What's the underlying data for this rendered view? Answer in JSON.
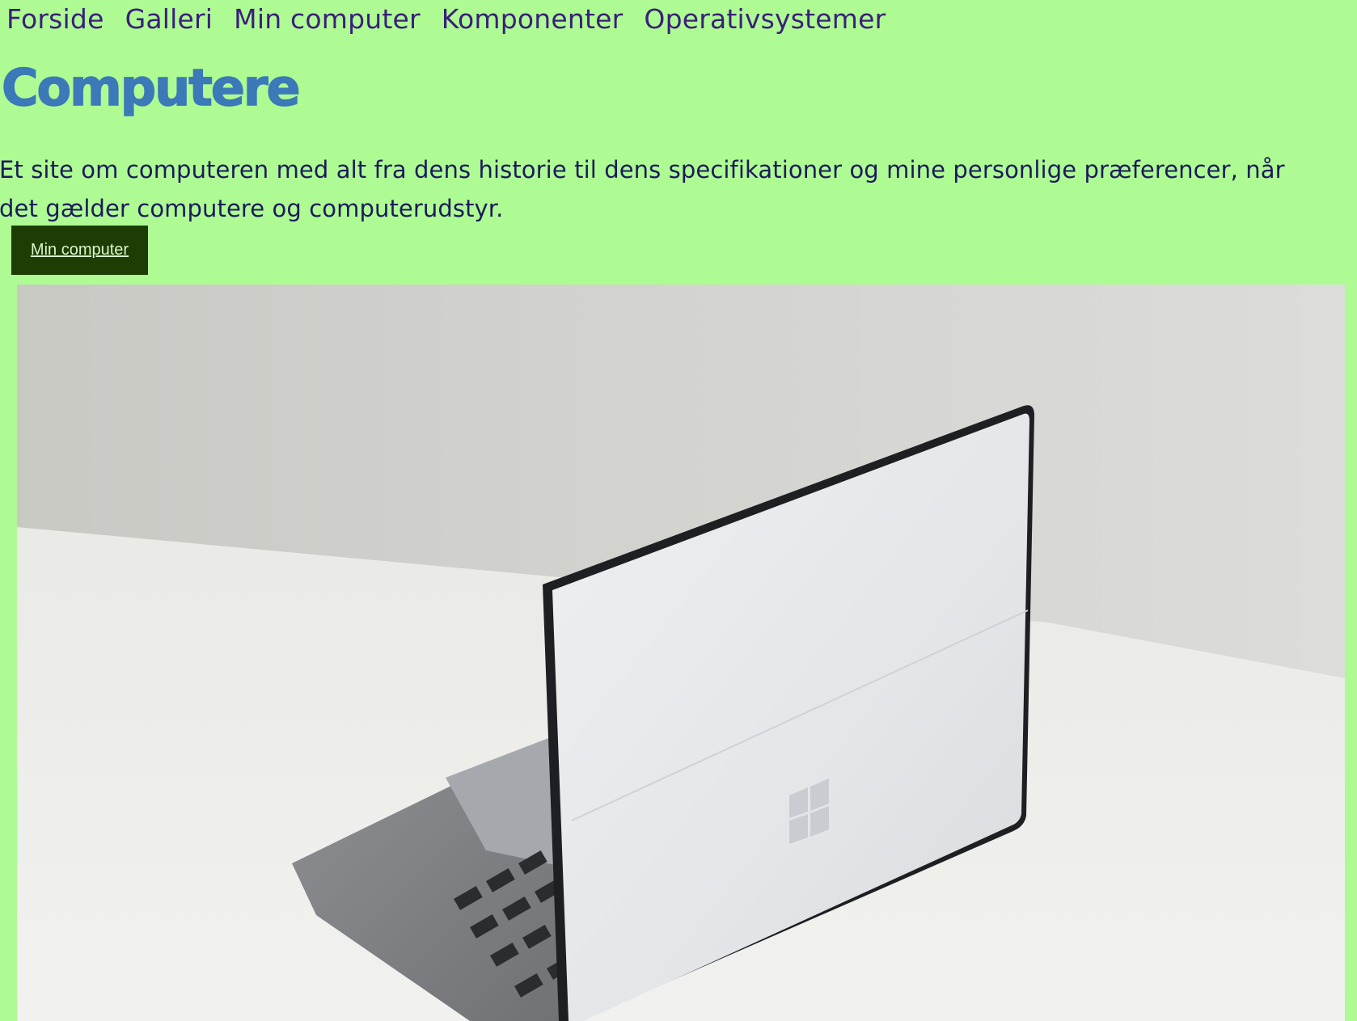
{
  "nav": {
    "items": [
      "Forside",
      "Galleri",
      "Min computer",
      "Komponenter",
      "Operativsystemer"
    ]
  },
  "hero": {
    "title": "Computere",
    "intro": "Et site om computeren med alt fra dens historie til dens specifikationer og mine personlige præferencer, når det gælder computere og computerudstyr.",
    "button_label": "Min computer"
  },
  "photo": {
    "subject": "laptop-photo"
  },
  "colors": {
    "background": "#aefb93",
    "nav_text": "#3a1f7a",
    "title": "#3b79b8",
    "body_text": "#1b1a5c",
    "button_bg": "#1e3d05",
    "button_text": "#d8f5c8"
  }
}
